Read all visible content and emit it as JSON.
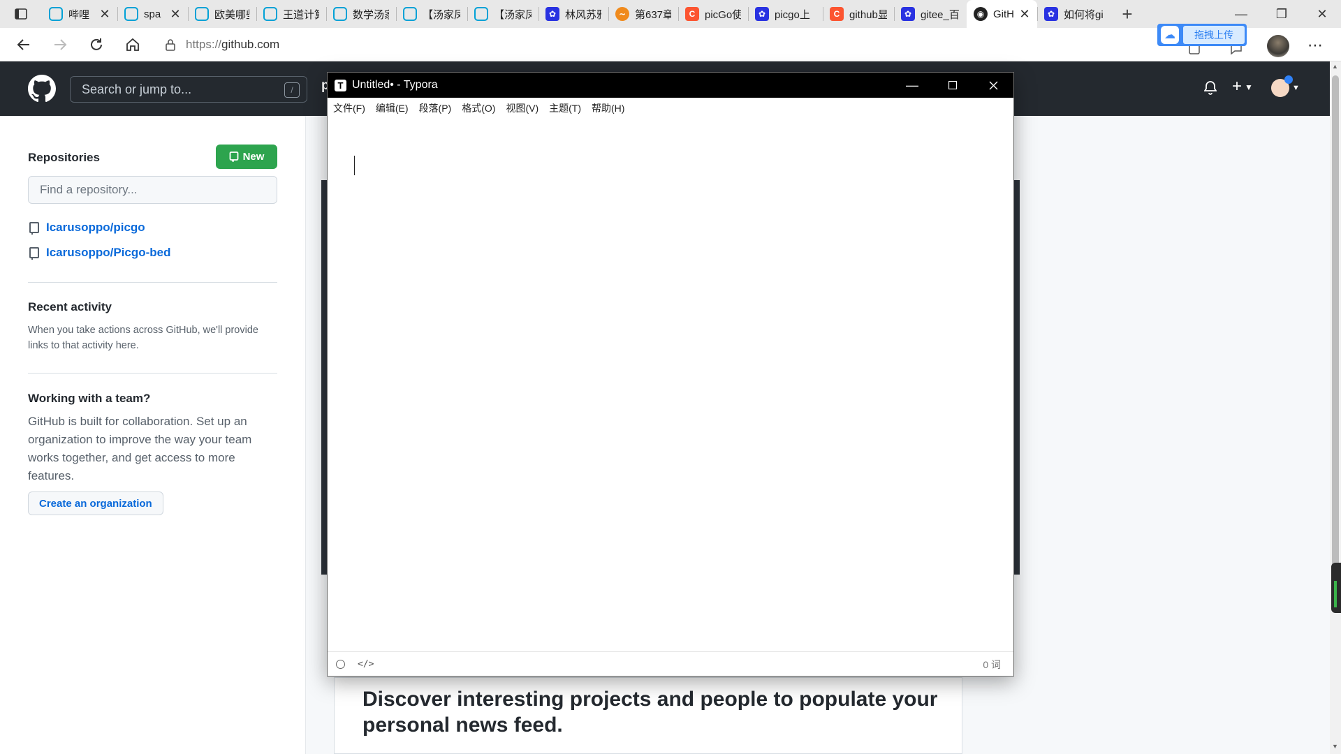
{
  "browser": {
    "tabs": [
      {
        "label": "哔哩",
        "favicon": "bilibili-icon",
        "closable": true
      },
      {
        "label": "spa",
        "favicon": "bilibili-icon",
        "closable": true
      },
      {
        "label": "欧美哪些",
        "favicon": "bilibili-icon"
      },
      {
        "label": "王道计算",
        "favicon": "bilibili-icon"
      },
      {
        "label": "数学汤家",
        "favicon": "bilibili-icon"
      },
      {
        "label": "【汤家凤",
        "favicon": "bilibili-icon"
      },
      {
        "label": "【汤家凤",
        "favicon": "bilibili-icon"
      },
      {
        "label": "林风苏雅",
        "favicon": "baidu-icon"
      },
      {
        "label": "第637章",
        "favicon": "qidian-icon"
      },
      {
        "label": "picGo使",
        "favicon": "csdn-icon"
      },
      {
        "label": "picgo上",
        "favicon": "baidu-icon"
      },
      {
        "label": "github显",
        "favicon": "csdn-icon"
      },
      {
        "label": "gitee_百",
        "favicon": "baidu-icon"
      },
      {
        "label": "GitH",
        "favicon": "github-icon",
        "active": true,
        "closable": true
      },
      {
        "label": "如何将gi",
        "favicon": "baidu-icon"
      }
    ],
    "url_scheme": "https://",
    "url_host": "github.com",
    "upload_widget_label": "拖拽上传"
  },
  "github": {
    "search_placeholder": "Search or jump to...",
    "search_shortcut": "/",
    "header_partial_char": "p",
    "repositories_heading": "Repositories",
    "new_button_label": "New",
    "find_repo_placeholder": "Find a repository...",
    "repos": [
      "Icarusoppo/picgo",
      "Icarusoppo/Picgo-bed"
    ],
    "recent_activity_heading": "Recent activity",
    "recent_activity_text": "When you take actions across GitHub, we'll provide links to that activity here.",
    "team_heading": "Working with a team?",
    "team_text": "GitHub is built for collaboration. Set up an organization to improve the way your team works together, and get access to more features.",
    "create_org_label": "Create an organization",
    "discover_heading": "Discover interesting projects and people to populate your personal news feed."
  },
  "typora": {
    "title": "Untitled• - Typora",
    "menu": [
      "文件(F)",
      "编辑(E)",
      "段落(P)",
      "格式(O)",
      "视图(V)",
      "主题(T)",
      "帮助(H)"
    ],
    "word_count": "0 词"
  }
}
